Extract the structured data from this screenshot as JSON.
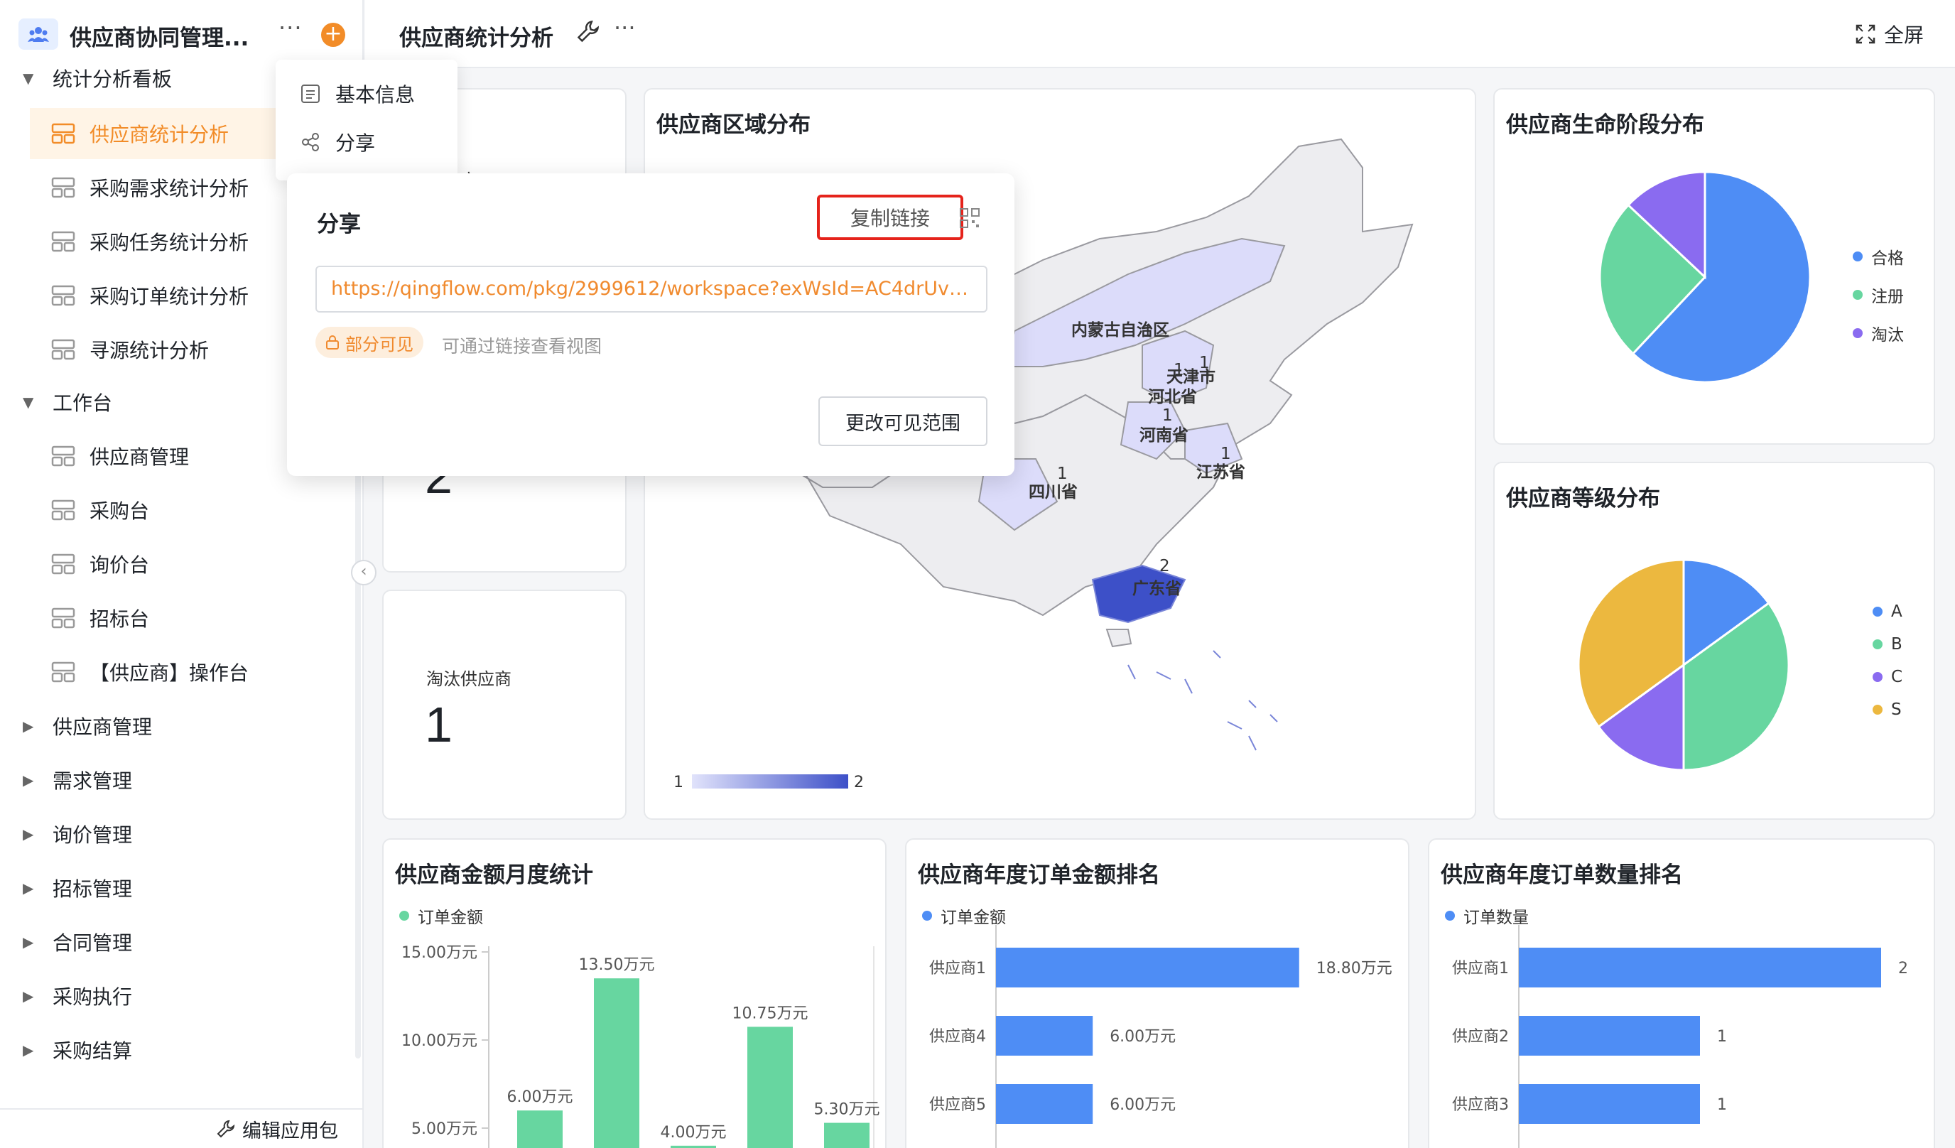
{
  "app": {
    "title": "供应商协同管理..."
  },
  "sidebar": {
    "groups": [
      {
        "label": "统计分析看板",
        "expanded": true
      },
      {
        "label": "工作台",
        "expanded": true
      }
    ],
    "dashboard_items": [
      "供应商统计分析",
      "采购需求统计分析",
      "采购任务统计分析",
      "采购订单统计分析",
      "寻源统计分析"
    ],
    "workbench_items": [
      "供应商管理",
      "采购台",
      "询价台",
      "招标台",
      "【供应商】操作台"
    ],
    "collapsed_groups": [
      "供应商管理",
      "需求管理",
      "询价管理",
      "招标管理",
      "合同管理",
      "采购执行",
      "采购结算"
    ],
    "footer": "编辑应用包"
  },
  "topbar": {
    "title": "供应商统计分析",
    "fullscreen": "全屏"
  },
  "menu_popup": {
    "items": [
      "基本信息",
      "分享"
    ]
  },
  "share": {
    "title": "分享",
    "copy_link": "复制链接",
    "url": "https://qingflow.com/pkg/2999612/workspace?exWsId=AC4drUvPm...",
    "visibility": "部分可见",
    "visibility_hint": "可通过链接查看视图",
    "change_scope": "更改可见范围"
  },
  "kpis": {
    "card1": {
      "label": "供应商",
      "value": "2"
    },
    "card2": {
      "label": "淘汰供应商",
      "value": "1"
    }
  },
  "colors": {
    "accent": "#f28c28",
    "blue": "#4e8df5",
    "green": "#67d6a0",
    "purple": "#8a6bf0",
    "yellow": "#ecb83f",
    "danger": "#e5231b"
  },
  "chart_data": [
    {
      "type": "map",
      "title": "供应商区域分布",
      "regions": [
        {
          "name": "内蒙古自治区",
          "value": 1
        },
        {
          "name": "天津市",
          "value": 1
        },
        {
          "name": "河北省",
          "value": 1
        },
        {
          "name": "河南省",
          "value": 1
        },
        {
          "name": "江苏省",
          "value": 1
        },
        {
          "name": "四川省",
          "value": 1
        },
        {
          "name": "广东省",
          "value": 2
        }
      ],
      "scale": {
        "min": 1,
        "max": 2
      }
    },
    {
      "type": "pie",
      "title": "供应商生命阶段分布",
      "labels": [
        "合格",
        "注册",
        "淘汰"
      ],
      "values": [
        62,
        25,
        13
      ],
      "colors": [
        "#4e8df5",
        "#67d6a0",
        "#8a6bf0"
      ]
    },
    {
      "type": "pie",
      "title": "供应商等级分布",
      "labels": [
        "A",
        "B",
        "C",
        "S"
      ],
      "values": [
        15,
        35,
        15,
        35
      ],
      "colors": [
        "#4e8df5",
        "#67d6a0",
        "#8a6bf0",
        "#ecb83f"
      ]
    },
    {
      "type": "bar",
      "title": "供应商金额月度统计",
      "series_name": "订单金额",
      "y_ticks": [
        "15.00万元",
        "10.00万元",
        "5.00万元"
      ],
      "ylim": [
        0,
        15
      ],
      "values": [
        6.0,
        13.5,
        4.0,
        10.75,
        5.3
      ],
      "labels": [
        "6.00万元",
        "13.50万元",
        "4.00万元",
        "10.75万元",
        "5.30万元"
      ]
    },
    {
      "type": "bar",
      "orientation": "horizontal",
      "title": "供应商年度订单金额排名",
      "series_name": "订单金额",
      "categories": [
        "供应商1",
        "供应商4",
        "供应商5"
      ],
      "values": [
        18.8,
        6.0,
        6.0
      ],
      "labels": [
        "18.80万元",
        "6.00万元",
        "6.00万元"
      ],
      "xlim": [
        0,
        20
      ]
    },
    {
      "type": "bar",
      "orientation": "horizontal",
      "title": "供应商年度订单数量排名",
      "series_name": "订单数量",
      "categories": [
        "供应商1",
        "供应商2",
        "供应商3"
      ],
      "values": [
        2,
        1,
        1
      ],
      "labels": [
        "2",
        "1",
        "1"
      ],
      "xlim": [
        0,
        2
      ]
    }
  ]
}
